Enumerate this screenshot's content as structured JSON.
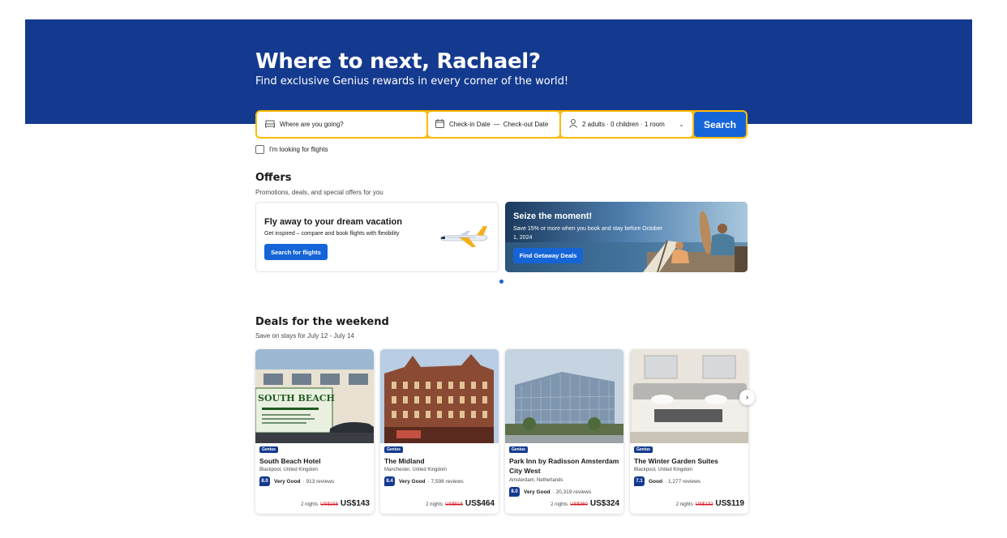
{
  "hero": {
    "title": "Where to next, Rachael?",
    "subtitle": "Find exclusive Genius rewards in every corner of the world!"
  },
  "search": {
    "destination_placeholder": "Where are you going?",
    "checkin": "Check-in Date",
    "dash": "—",
    "checkout": "Check-out Date",
    "guests": "2 adults · 0 children · 1 room",
    "button": "Search",
    "flights_checkbox": "I'm looking for flights"
  },
  "offers": {
    "title": "Offers",
    "subtitle": "Promotions, deals, and special offers for you",
    "cards": [
      {
        "title": "Fly away to your dream vacation",
        "text": "Get inspired – compare and book flights with flexibility",
        "button": "Search for flights"
      },
      {
        "title": "Seize the moment!",
        "text": "Save 15% or more when you book and stay before October 1, 2024",
        "button": "Find Getaway Deals"
      }
    ]
  },
  "deals": {
    "title": "Deals for the weekend",
    "subtitle": "Save on stays for July 12 - July 14",
    "badge": "Genius",
    "nights": "2 nights",
    "items": [
      {
        "name": "South Beach Hotel",
        "location": "Blackpool, United Kingdom",
        "score": "8.0",
        "label": "Very Good",
        "reviews": "· 913 reviews",
        "old_price": "US$158",
        "price": "US$143"
      },
      {
        "name": "The Midland",
        "location": "Manchester, United Kingdom",
        "score": "8.4",
        "label": "Very Good",
        "reviews": "· 7,598 reviews",
        "old_price": "US$516",
        "price": "US$464"
      },
      {
        "name": "Park Inn by Radisson Amsterdam City West",
        "location": "Amsterdam, Netherlands",
        "score": "8.0",
        "label": "Very Good",
        "reviews": "· 20,319 reviews",
        "old_price": "US$360",
        "price": "US$324"
      },
      {
        "name": "The Winter Garden Suites",
        "location": "Blackpool, United Kingdom",
        "score": "7.1",
        "label": "Good",
        "reviews": "· 1,277 reviews",
        "old_price": "US$132",
        "price": "US$119"
      }
    ]
  },
  "image_text": {
    "hotel_sign": "SOUTH BEACH"
  },
  "colors": {
    "brand_blue": "#143a8f",
    "action_blue": "#1565d8",
    "search_border": "#febb02",
    "strike_red": "#d4111e"
  }
}
